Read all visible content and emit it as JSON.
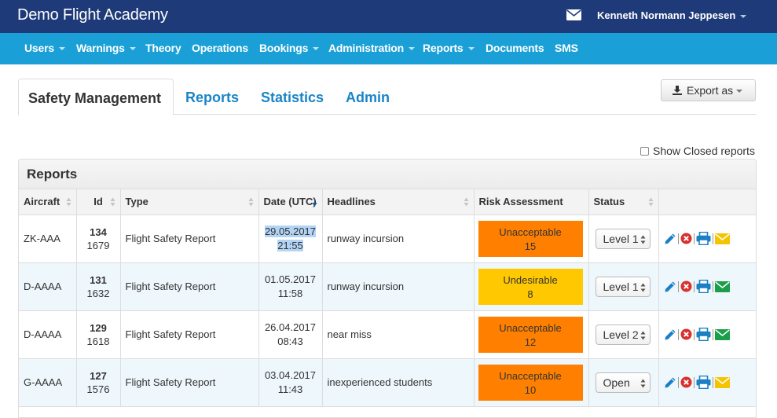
{
  "header": {
    "app_title": "Demo Flight Academy",
    "user_name": "Kenneth Normann Jeppesen"
  },
  "nav": {
    "items": [
      {
        "label": "Users",
        "dropdown": true
      },
      {
        "label": "Warnings",
        "dropdown": true
      },
      {
        "label": "Theory",
        "dropdown": false
      },
      {
        "label": "Operations",
        "dropdown": false
      },
      {
        "label": "Bookings",
        "dropdown": true
      },
      {
        "label": "Administration",
        "dropdown": true
      },
      {
        "label": "Reports",
        "dropdown": true
      },
      {
        "label": "Documents",
        "dropdown": false
      },
      {
        "label": "SMS",
        "dropdown": false
      }
    ]
  },
  "tabs": [
    {
      "label": "Safety Management",
      "active": true
    },
    {
      "label": "Reports",
      "active": false
    },
    {
      "label": "Statistics",
      "active": false
    },
    {
      "label": "Admin",
      "active": false
    }
  ],
  "toolbar": {
    "export_label": "Export as"
  },
  "filters": {
    "show_closed_label": "Show Closed reports",
    "show_closed_checked": false
  },
  "reports_panel": {
    "title": "Reports",
    "columns": [
      "Aircraft",
      "Id",
      "Type",
      "Date (UTC)",
      "Headlines",
      "Risk Assessment",
      "Status"
    ],
    "rows": [
      {
        "aircraft": "ZK-AAA",
        "id": "134",
        "sub_id": "1679",
        "type": "Flight Safety Report",
        "date": "29.05.2017",
        "time": "21:55",
        "headline": "runway incursion",
        "risk_label": "Unacceptable",
        "risk_score": "15",
        "risk_color": "#ff8000",
        "status": "Level 1",
        "mail_color": "#f5c400"
      },
      {
        "aircraft": "D-AAAA",
        "id": "131",
        "sub_id": "1632",
        "type": "Flight Safety Report",
        "date": "01.05.2017",
        "time": "11:58",
        "headline": "runway incursion",
        "risk_label": "Undesirable",
        "risk_score": "8",
        "risk_color": "#ffc800",
        "status": "Level 1",
        "mail_color": "#1a9e4a"
      },
      {
        "aircraft": "D-AAAA",
        "id": "129",
        "sub_id": "1618",
        "type": "Flight Safety Report",
        "date": "26.04.2017",
        "time": "08:43",
        "headline": "near miss",
        "risk_label": "Unacceptable",
        "risk_score": "12",
        "risk_color": "#ff8000",
        "status": "Level 2",
        "mail_color": "#1a9e4a"
      },
      {
        "aircraft": "G-AAAA",
        "id": "127",
        "sub_id": "1576",
        "type": "Flight Safety Report",
        "date": "03.04.2017",
        "time": "11:43",
        "headline": "inexperienced students",
        "risk_label": "Unacceptable",
        "risk_score": "10",
        "risk_color": "#ff8000",
        "status": "Open",
        "mail_color": "#f5c400"
      }
    ]
  },
  "colors": {
    "topbar": "#1f3a78",
    "navbar": "#1aa0d7",
    "link": "#1a85c6",
    "edit_icon": "#1a7fc4",
    "delete_icon": "#d9312b"
  },
  "icons": {
    "mail": "envelope-icon",
    "export": "download-icon",
    "edit": "pencil-icon",
    "delete": "remove-circle-icon",
    "print": "printer-icon",
    "notify": "envelope-icon"
  }
}
